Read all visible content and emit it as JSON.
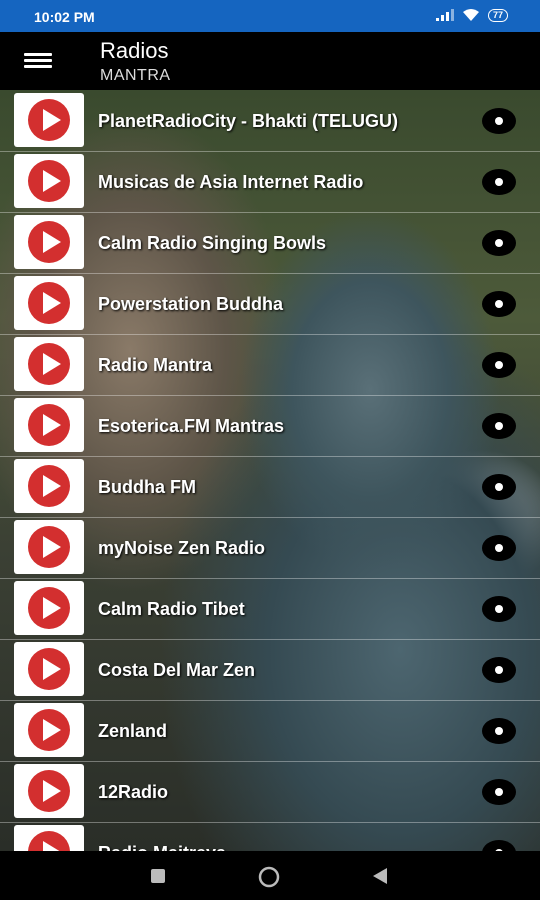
{
  "status_bar": {
    "time": "10:02 PM",
    "battery": "77"
  },
  "app_bar": {
    "title": "Radios",
    "subtitle": "MANTRA"
  },
  "stations": [
    {
      "name": "PlanetRadioCity - Bhakti (TELUGU)"
    },
    {
      "name": "Musicas de Asia Internet Radio"
    },
    {
      "name": "Calm Radio Singing Bowls"
    },
    {
      "name": "Powerstation Buddha"
    },
    {
      "name": "Radio Mantra"
    },
    {
      "name": "Esoterica.FM Mantras"
    },
    {
      "name": "Buddha FM"
    },
    {
      "name": "myNoise Zen Radio"
    },
    {
      "name": "Calm Radio Tibet"
    },
    {
      "name": "Costa Del Mar Zen"
    },
    {
      "name": "Zenland"
    },
    {
      "name": "12Radio"
    },
    {
      "name": "Radio Maitreya"
    }
  ],
  "icons": {
    "menu": "hamburger-menu-icon",
    "play": "play-button-icon",
    "more": "options-dot-icon"
  },
  "colors": {
    "status_bar": "#1565C0",
    "play_red": "#D32F2F",
    "app_bar": "#000000"
  }
}
